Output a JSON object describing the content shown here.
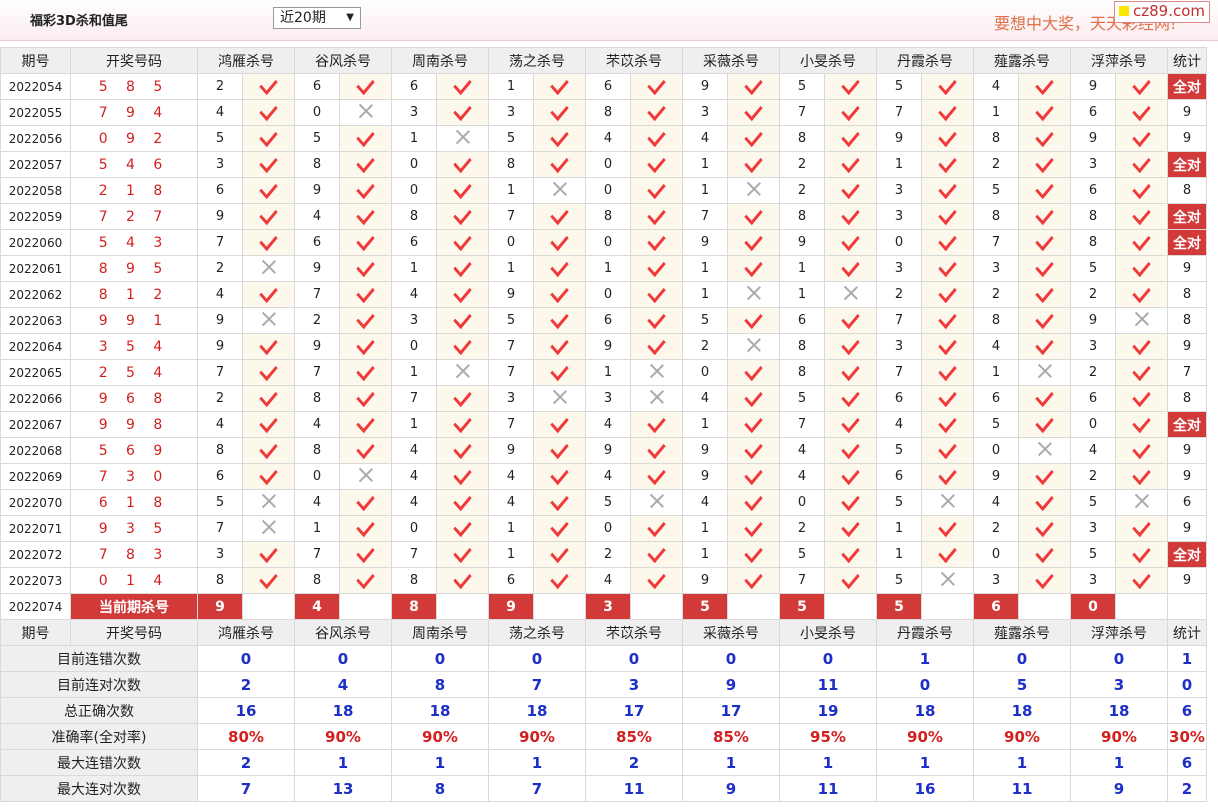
{
  "header": {
    "title": "福彩3D杀和值尾",
    "select_value": "近20期",
    "slogan": "要想中大奖，天天彩经网!",
    "logo_text": "cz89.com"
  },
  "table": {
    "col_period": "期号",
    "col_numbers": "开奖号码",
    "experts": [
      "鸿雁杀号",
      "谷风杀号",
      "周南杀号",
      "荡之杀号",
      "芣苡杀号",
      "采薇杀号",
      "小旻杀号",
      "丹霞杀号",
      "薤露杀号",
      "浮萍杀号"
    ],
    "col_stat": "统计",
    "check_icon": "check-icon",
    "cross_icon": "cross-icon",
    "rows": [
      {
        "period": "2022054",
        "numbers": "5 8 5",
        "kills": [
          [
            2,
            1
          ],
          [
            6,
            1
          ],
          [
            6,
            1
          ],
          [
            1,
            1
          ],
          [
            6,
            1
          ],
          [
            9,
            1
          ],
          [
            5,
            1
          ],
          [
            5,
            1
          ],
          [
            4,
            1
          ],
          [
            9,
            1
          ]
        ],
        "stat": "全对"
      },
      {
        "period": "2022055",
        "numbers": "7 9 4",
        "kills": [
          [
            4,
            1
          ],
          [
            0,
            0
          ],
          [
            3,
            1
          ],
          [
            3,
            1
          ],
          [
            8,
            1
          ],
          [
            3,
            1
          ],
          [
            7,
            1
          ],
          [
            7,
            1
          ],
          [
            1,
            1
          ],
          [
            6,
            1
          ]
        ],
        "stat": "9"
      },
      {
        "period": "2022056",
        "numbers": "0 9 2",
        "kills": [
          [
            5,
            1
          ],
          [
            5,
            1
          ],
          [
            1,
            0
          ],
          [
            5,
            1
          ],
          [
            4,
            1
          ],
          [
            4,
            1
          ],
          [
            8,
            1
          ],
          [
            9,
            1
          ],
          [
            8,
            1
          ],
          [
            9,
            1
          ]
        ],
        "stat": "9"
      },
      {
        "period": "2022057",
        "numbers": "5 4 6",
        "kills": [
          [
            3,
            1
          ],
          [
            8,
            1
          ],
          [
            0,
            1
          ],
          [
            8,
            1
          ],
          [
            0,
            1
          ],
          [
            1,
            1
          ],
          [
            2,
            1
          ],
          [
            1,
            1
          ],
          [
            2,
            1
          ],
          [
            3,
            1
          ]
        ],
        "stat": "全对"
      },
      {
        "period": "2022058",
        "numbers": "2 1 8",
        "kills": [
          [
            6,
            1
          ],
          [
            9,
            1
          ],
          [
            0,
            1
          ],
          [
            1,
            0
          ],
          [
            0,
            1
          ],
          [
            1,
            0
          ],
          [
            2,
            1
          ],
          [
            3,
            1
          ],
          [
            5,
            1
          ],
          [
            6,
            1
          ]
        ],
        "stat": "8"
      },
      {
        "period": "2022059",
        "numbers": "7 2 7",
        "kills": [
          [
            9,
            1
          ],
          [
            4,
            1
          ],
          [
            8,
            1
          ],
          [
            7,
            1
          ],
          [
            8,
            1
          ],
          [
            7,
            1
          ],
          [
            8,
            1
          ],
          [
            3,
            1
          ],
          [
            8,
            1
          ],
          [
            8,
            1
          ]
        ],
        "stat": "全对"
      },
      {
        "period": "2022060",
        "numbers": "5 4 3",
        "kills": [
          [
            7,
            1
          ],
          [
            6,
            1
          ],
          [
            6,
            1
          ],
          [
            0,
            1
          ],
          [
            0,
            1
          ],
          [
            9,
            1
          ],
          [
            9,
            1
          ],
          [
            0,
            1
          ],
          [
            7,
            1
          ],
          [
            8,
            1
          ]
        ],
        "stat": "全对"
      },
      {
        "period": "2022061",
        "numbers": "8 9 5",
        "kills": [
          [
            2,
            0
          ],
          [
            9,
            1
          ],
          [
            1,
            1
          ],
          [
            1,
            1
          ],
          [
            1,
            1
          ],
          [
            1,
            1
          ],
          [
            1,
            1
          ],
          [
            3,
            1
          ],
          [
            3,
            1
          ],
          [
            5,
            1
          ]
        ],
        "stat": "9"
      },
      {
        "period": "2022062",
        "numbers": "8 1 2",
        "kills": [
          [
            4,
            1
          ],
          [
            7,
            1
          ],
          [
            4,
            1
          ],
          [
            9,
            1
          ],
          [
            0,
            1
          ],
          [
            1,
            0
          ],
          [
            1,
            0
          ],
          [
            2,
            1
          ],
          [
            2,
            1
          ],
          [
            2,
            1
          ]
        ],
        "stat": "8"
      },
      {
        "period": "2022063",
        "numbers": "9 9 1",
        "kills": [
          [
            9,
            0
          ],
          [
            2,
            1
          ],
          [
            3,
            1
          ],
          [
            5,
            1
          ],
          [
            6,
            1
          ],
          [
            5,
            1
          ],
          [
            6,
            1
          ],
          [
            7,
            1
          ],
          [
            8,
            1
          ],
          [
            9,
            0
          ]
        ],
        "stat": "8"
      },
      {
        "period": "2022064",
        "numbers": "3 5 4",
        "kills": [
          [
            9,
            1
          ],
          [
            9,
            1
          ],
          [
            0,
            1
          ],
          [
            7,
            1
          ],
          [
            9,
            1
          ],
          [
            2,
            0
          ],
          [
            8,
            1
          ],
          [
            3,
            1
          ],
          [
            4,
            1
          ],
          [
            3,
            1
          ]
        ],
        "stat": "9"
      },
      {
        "period": "2022065",
        "numbers": "2 5 4",
        "kills": [
          [
            7,
            1
          ],
          [
            7,
            1
          ],
          [
            1,
            0
          ],
          [
            7,
            1
          ],
          [
            1,
            0
          ],
          [
            0,
            1
          ],
          [
            8,
            1
          ],
          [
            7,
            1
          ],
          [
            1,
            0
          ],
          [
            2,
            1
          ]
        ],
        "stat": "7"
      },
      {
        "period": "2022066",
        "numbers": "9 6 8",
        "kills": [
          [
            2,
            1
          ],
          [
            8,
            1
          ],
          [
            7,
            1
          ],
          [
            3,
            0
          ],
          [
            3,
            0
          ],
          [
            4,
            1
          ],
          [
            5,
            1
          ],
          [
            6,
            1
          ],
          [
            6,
            1
          ],
          [
            6,
            1
          ]
        ],
        "stat": "8"
      },
      {
        "period": "2022067",
        "numbers": "9 9 8",
        "kills": [
          [
            4,
            1
          ],
          [
            4,
            1
          ],
          [
            1,
            1
          ],
          [
            7,
            1
          ],
          [
            4,
            1
          ],
          [
            1,
            1
          ],
          [
            7,
            1
          ],
          [
            4,
            1
          ],
          [
            5,
            1
          ],
          [
            0,
            1
          ]
        ],
        "stat": "全对"
      },
      {
        "period": "2022068",
        "numbers": "5 6 9",
        "kills": [
          [
            8,
            1
          ],
          [
            8,
            1
          ],
          [
            4,
            1
          ],
          [
            9,
            1
          ],
          [
            9,
            1
          ],
          [
            9,
            1
          ],
          [
            4,
            1
          ],
          [
            5,
            1
          ],
          [
            0,
            0
          ],
          [
            4,
            1
          ]
        ],
        "stat": "9"
      },
      {
        "period": "2022069",
        "numbers": "7 3 0",
        "kills": [
          [
            6,
            1
          ],
          [
            0,
            0
          ],
          [
            4,
            1
          ],
          [
            4,
            1
          ],
          [
            4,
            1
          ],
          [
            9,
            1
          ],
          [
            4,
            1
          ],
          [
            6,
            1
          ],
          [
            9,
            1
          ],
          [
            2,
            1
          ]
        ],
        "stat": "9"
      },
      {
        "period": "2022070",
        "numbers": "6 1 8",
        "kills": [
          [
            5,
            0
          ],
          [
            4,
            1
          ],
          [
            4,
            1
          ],
          [
            4,
            1
          ],
          [
            5,
            0
          ],
          [
            4,
            1
          ],
          [
            0,
            1
          ],
          [
            5,
            0
          ],
          [
            4,
            1
          ],
          [
            5,
            0
          ]
        ],
        "stat": "6"
      },
      {
        "period": "2022071",
        "numbers": "9 3 5",
        "kills": [
          [
            7,
            0
          ],
          [
            1,
            1
          ],
          [
            0,
            1
          ],
          [
            1,
            1
          ],
          [
            0,
            1
          ],
          [
            1,
            1
          ],
          [
            2,
            1
          ],
          [
            1,
            1
          ],
          [
            2,
            1
          ],
          [
            3,
            1
          ]
        ],
        "stat": "9"
      },
      {
        "period": "2022072",
        "numbers": "7 8 3",
        "kills": [
          [
            3,
            1
          ],
          [
            7,
            1
          ],
          [
            7,
            1
          ],
          [
            1,
            1
          ],
          [
            2,
            1
          ],
          [
            1,
            1
          ],
          [
            5,
            1
          ],
          [
            1,
            1
          ],
          [
            0,
            1
          ],
          [
            5,
            1
          ]
        ],
        "stat": "全对"
      },
      {
        "period": "2022073",
        "numbers": "0 1 4",
        "kills": [
          [
            8,
            1
          ],
          [
            8,
            1
          ],
          [
            8,
            1
          ],
          [
            6,
            1
          ],
          [
            4,
            1
          ],
          [
            9,
            1
          ],
          [
            7,
            1
          ],
          [
            5,
            0
          ],
          [
            3,
            1
          ],
          [
            3,
            1
          ]
        ],
        "stat": "9"
      }
    ],
    "current": {
      "period": "2022074",
      "label": "当前期杀号",
      "values": [
        "9",
        "4",
        "8",
        "9",
        "3",
        "5",
        "5",
        "5",
        "6",
        "0"
      ]
    },
    "summary": [
      {
        "label": "目前连错次数",
        "values": [
          "0",
          "0",
          "0",
          "0",
          "0",
          "0",
          "0",
          "1",
          "0",
          "0"
        ],
        "stat": "1",
        "color": "blue"
      },
      {
        "label": "目前连对次数",
        "values": [
          "2",
          "4",
          "8",
          "7",
          "3",
          "9",
          "11",
          "0",
          "5",
          "3"
        ],
        "stat": "0",
        "color": "blue"
      },
      {
        "label": "总正确次数",
        "values": [
          "16",
          "18",
          "18",
          "18",
          "17",
          "17",
          "19",
          "18",
          "18",
          "18"
        ],
        "stat": "6",
        "color": "blue"
      },
      {
        "label": "准确率(全对率)",
        "values": [
          "80%",
          "90%",
          "90%",
          "90%",
          "85%",
          "85%",
          "95%",
          "90%",
          "90%",
          "90%"
        ],
        "stat": "30%",
        "color": "red"
      },
      {
        "label": "最大连错次数",
        "values": [
          "2",
          "1",
          "1",
          "1",
          "2",
          "1",
          "1",
          "1",
          "1",
          "1"
        ],
        "stat": "6",
        "color": "blue"
      },
      {
        "label": "最大连对次数",
        "values": [
          "7",
          "13",
          "8",
          "7",
          "11",
          "9",
          "11",
          "16",
          "11",
          "9"
        ],
        "stat": "2",
        "color": "blue"
      }
    ]
  }
}
